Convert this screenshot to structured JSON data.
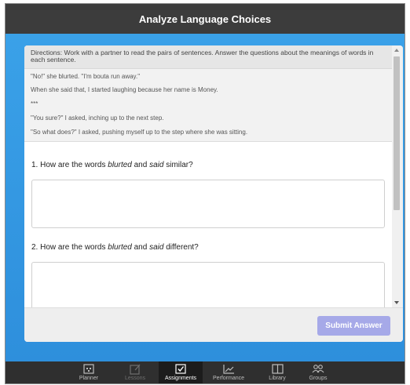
{
  "header": {
    "title": "Analyze Language Choices"
  },
  "directions": "Directions: Work with a partner to read the pairs of sentences. Answer the questions about the meanings of words in each sentence.",
  "passage": [
    "\"No!\" she blurted. \"I'm bouta run away.\"",
    "When she said that, I started laughing because her name is Money.",
    "***",
    "\"You sure?\" I asked, inching up to the next step.",
    "\"So what does?\" I asked, pushing myself up to the step where she was sitting."
  ],
  "questions": [
    {
      "prefix": "1. How are the words ",
      "word1": "blurted",
      "and": " and ",
      "word2": "said",
      "suffix": " similar?"
    },
    {
      "prefix": "2. How are the words ",
      "word1": "blurted",
      "and": " and ",
      "word2": "said",
      "suffix": " different?"
    }
  ],
  "footer": {
    "submit_label": "Submit Answer"
  },
  "nav": [
    {
      "label": "Planner",
      "icon": "planner-icon",
      "state": "normal"
    },
    {
      "label": "Lessons",
      "icon": "lessons-icon",
      "state": "disabled"
    },
    {
      "label": "Assignments",
      "icon": "assignments-icon",
      "state": "active"
    },
    {
      "label": "Performance",
      "icon": "performance-icon",
      "state": "normal"
    },
    {
      "label": "Library",
      "icon": "library-icon",
      "state": "normal"
    },
    {
      "label": "Groups",
      "icon": "groups-icon",
      "state": "normal"
    }
  ],
  "colors": {
    "title_bar": "#3c3c3c",
    "background": "#2e8fdc",
    "submit_button": "#a6a9e8",
    "nav_bar": "#2f2f2f"
  }
}
